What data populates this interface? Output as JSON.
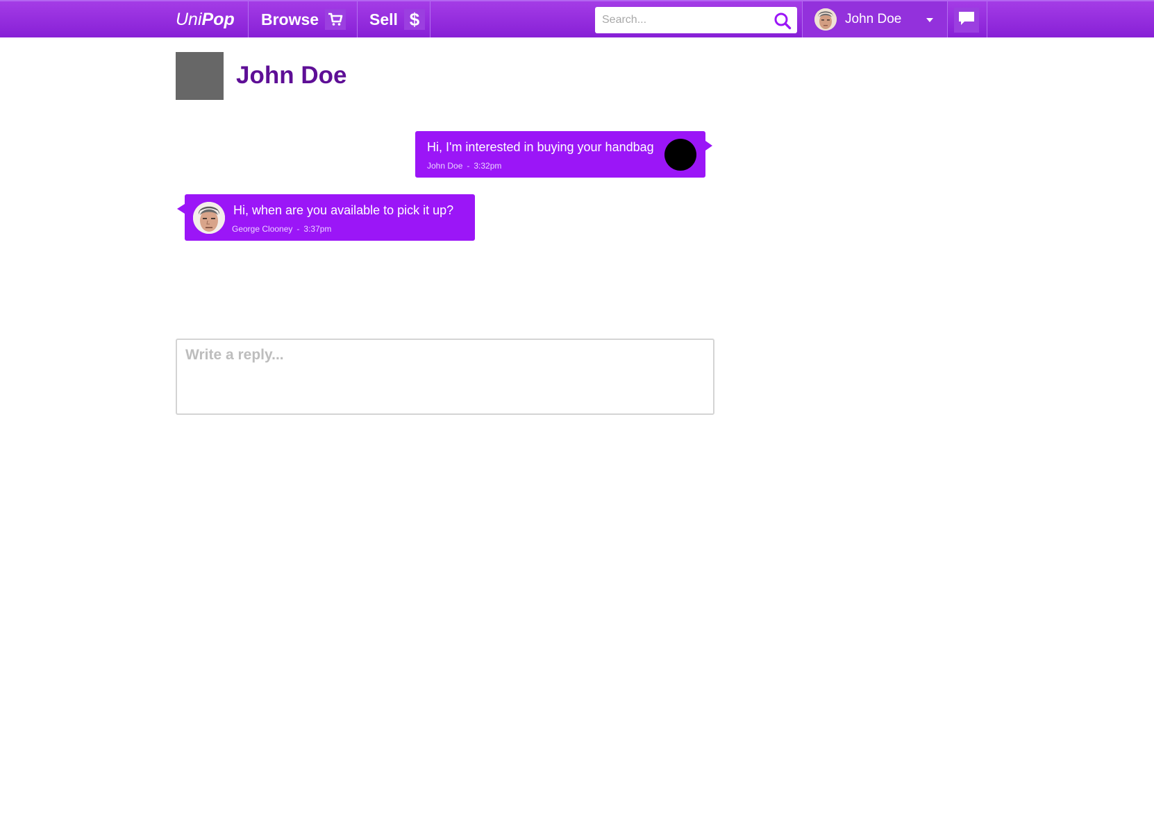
{
  "nav": {
    "brand_uni": "Uni",
    "brand_pop": "Pop",
    "browse_label": "Browse",
    "browse_icon": "cart-icon",
    "sell_label": "Sell",
    "sell_icon_glyph": "$",
    "search_placeholder": "Search...",
    "user_name": "John Doe",
    "messages_icon": "chat-icon",
    "accent_color": "#9b16f7"
  },
  "conversation": {
    "title": "John Doe",
    "messages": [
      {
        "text": "Hi, I'm interested in buying your handbag",
        "author": "John Doe",
        "sep": "-",
        "time": "3:32pm",
        "side": "right"
      },
      {
        "text": "Hi, when are you available to pick it up?",
        "author": "George Clooney",
        "sep": "-",
        "time": "3:37pm",
        "side": "left"
      }
    ]
  },
  "reply": {
    "placeholder": "Write a reply..."
  }
}
